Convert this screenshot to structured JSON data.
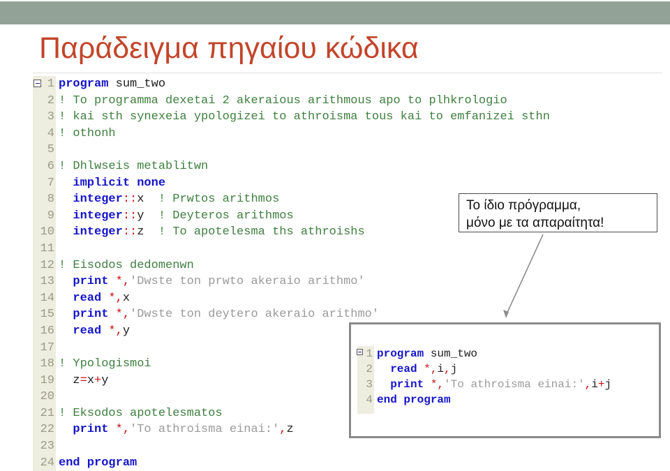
{
  "slide": {
    "title": "Παράδειγμα πηγαίου κώδικα",
    "title_color": "#c2452a",
    "band_color": "#93a296",
    "background_color": "#ffffff"
  },
  "syntax_colors": {
    "keyword": "#1515c8",
    "comment": "#3f7f3f",
    "string": "#9a9a9a",
    "operator": "#cc1111",
    "plain": "#202020",
    "line_number": "#9a9a86",
    "gutter_background": "#edede0"
  },
  "main_code": {
    "language": "Fortran",
    "fold_marker_line": 1,
    "lines": [
      {
        "n": "1",
        "tokens": [
          {
            "t": "kw",
            "v": "program"
          },
          {
            "t": "pl",
            "v": " sum_two"
          }
        ]
      },
      {
        "n": "2",
        "tokens": [
          {
            "t": "cmt",
            "v": "! To programma dexetai 2 akeraious arithmous apo to plhkrologio"
          }
        ]
      },
      {
        "n": "3",
        "tokens": [
          {
            "t": "cmt",
            "v": "! kai sth synexeia ypologizei to athroisma tous kai to emfanizei sthn"
          }
        ]
      },
      {
        "n": "4",
        "tokens": [
          {
            "t": "cmt",
            "v": "! othonh"
          }
        ]
      },
      {
        "n": "5",
        "tokens": [
          {
            "t": "pl",
            "v": ""
          }
        ]
      },
      {
        "n": "6",
        "tokens": [
          {
            "t": "cmt",
            "v": "! Dhlwseis metablitwn"
          }
        ]
      },
      {
        "n": "7",
        "tokens": [
          {
            "t": "pl",
            "v": "  "
          },
          {
            "t": "kw",
            "v": "implicit none"
          }
        ]
      },
      {
        "n": "8",
        "tokens": [
          {
            "t": "pl",
            "v": "  "
          },
          {
            "t": "kw",
            "v": "integer"
          },
          {
            "t": "op",
            "v": "::"
          },
          {
            "t": "pl",
            "v": "x  "
          },
          {
            "t": "cmt",
            "v": "! Prwtos arithmos"
          }
        ]
      },
      {
        "n": "9",
        "tokens": [
          {
            "t": "pl",
            "v": "  "
          },
          {
            "t": "kw",
            "v": "integer"
          },
          {
            "t": "op",
            "v": "::"
          },
          {
            "t": "pl",
            "v": "y  "
          },
          {
            "t": "cmt",
            "v": "! Deyteros arithmos"
          }
        ]
      },
      {
        "n": "10",
        "tokens": [
          {
            "t": "pl",
            "v": "  "
          },
          {
            "t": "kw",
            "v": "integer"
          },
          {
            "t": "op",
            "v": "::"
          },
          {
            "t": "pl",
            "v": "z  "
          },
          {
            "t": "cmt",
            "v": "! To apotelesma ths athroishs"
          }
        ]
      },
      {
        "n": "11",
        "tokens": [
          {
            "t": "pl",
            "v": ""
          }
        ]
      },
      {
        "n": "12",
        "tokens": [
          {
            "t": "cmt",
            "v": "! Eisodos dedomenwn"
          }
        ]
      },
      {
        "n": "13",
        "tokens": [
          {
            "t": "pl",
            "v": "  "
          },
          {
            "t": "kw",
            "v": "print"
          },
          {
            "t": "pl",
            "v": " "
          },
          {
            "t": "op",
            "v": "*,"
          },
          {
            "t": "str",
            "v": "'Dwste ton prwto akeraio arithmo'"
          }
        ]
      },
      {
        "n": "14",
        "tokens": [
          {
            "t": "pl",
            "v": "  "
          },
          {
            "t": "kw",
            "v": "read"
          },
          {
            "t": "pl",
            "v": " "
          },
          {
            "t": "op",
            "v": "*,"
          },
          {
            "t": "pl",
            "v": "x"
          }
        ]
      },
      {
        "n": "15",
        "tokens": [
          {
            "t": "pl",
            "v": "  "
          },
          {
            "t": "kw",
            "v": "print"
          },
          {
            "t": "pl",
            "v": " "
          },
          {
            "t": "op",
            "v": "*,"
          },
          {
            "t": "str",
            "v": "'Dwste ton deytero akeraio arithmo'"
          }
        ]
      },
      {
        "n": "16",
        "tokens": [
          {
            "t": "pl",
            "v": "  "
          },
          {
            "t": "kw",
            "v": "read"
          },
          {
            "t": "pl",
            "v": " "
          },
          {
            "t": "op",
            "v": "*,"
          },
          {
            "t": "pl",
            "v": "y"
          }
        ]
      },
      {
        "n": "17",
        "tokens": [
          {
            "t": "pl",
            "v": ""
          }
        ]
      },
      {
        "n": "18",
        "tokens": [
          {
            "t": "cmt",
            "v": "! Ypologismoi"
          }
        ]
      },
      {
        "n": "19",
        "tokens": [
          {
            "t": "pl",
            "v": "  z"
          },
          {
            "t": "op",
            "v": "="
          },
          {
            "t": "pl",
            "v": "x"
          },
          {
            "t": "op",
            "v": "+"
          },
          {
            "t": "pl",
            "v": "y"
          }
        ]
      },
      {
        "n": "20",
        "tokens": [
          {
            "t": "pl",
            "v": ""
          }
        ]
      },
      {
        "n": "21",
        "tokens": [
          {
            "t": "cmt",
            "v": "! Eksodos apotelesmatos"
          }
        ]
      },
      {
        "n": "22",
        "tokens": [
          {
            "t": "pl",
            "v": "  "
          },
          {
            "t": "kw",
            "v": "print"
          },
          {
            "t": "pl",
            "v": " "
          },
          {
            "t": "op",
            "v": "*,"
          },
          {
            "t": "str",
            "v": "'To athroisma einai:'"
          },
          {
            "t": "op",
            "v": ","
          },
          {
            "t": "pl",
            "v": "z"
          }
        ]
      },
      {
        "n": "23",
        "tokens": [
          {
            "t": "pl",
            "v": ""
          }
        ]
      },
      {
        "n": "24",
        "tokens": [
          {
            "t": "kw",
            "v": "end program"
          }
        ]
      }
    ]
  },
  "callout": {
    "lines": [
      "Το ίδιο πρόγραμμα,",
      "μόνο με τα απαραίτητα!"
    ],
    "border_color": "#4a4a4a"
  },
  "arrow": {
    "color": "#8d8d8d",
    "points_to": "inset-code-box"
  },
  "inset_code": {
    "language": "Fortran",
    "fold_marker_line": 1,
    "border_color": "#8a8a8a",
    "lines": [
      {
        "n": "1",
        "tokens": [
          {
            "t": "kw",
            "v": "program"
          },
          {
            "t": "pl",
            "v": " sum_two"
          }
        ]
      },
      {
        "n": "2",
        "tokens": [
          {
            "t": "pl",
            "v": "  "
          },
          {
            "t": "kw",
            "v": "read"
          },
          {
            "t": "pl",
            "v": " "
          },
          {
            "t": "op",
            "v": "*,"
          },
          {
            "t": "pl",
            "v": "i"
          },
          {
            "t": "op",
            "v": ","
          },
          {
            "t": "pl",
            "v": "j"
          }
        ]
      },
      {
        "n": "3",
        "tokens": [
          {
            "t": "pl",
            "v": "  "
          },
          {
            "t": "kw",
            "v": "print"
          },
          {
            "t": "pl",
            "v": " "
          },
          {
            "t": "op",
            "v": "*,"
          },
          {
            "t": "str",
            "v": "'To athroisma einai:'"
          },
          {
            "t": "op",
            "v": ","
          },
          {
            "t": "pl",
            "v": "i"
          },
          {
            "t": "op",
            "v": "+"
          },
          {
            "t": "pl",
            "v": "j"
          }
        ]
      },
      {
        "n": "4",
        "tokens": [
          {
            "t": "kw",
            "v": "end program"
          }
        ]
      }
    ]
  }
}
